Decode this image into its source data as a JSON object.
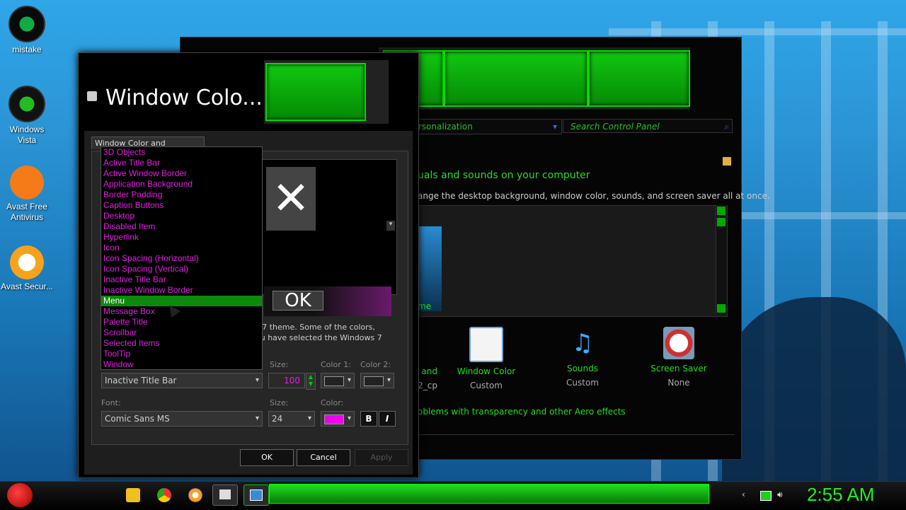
{
  "desktop": {
    "icons": [
      {
        "label": "mistake",
        "icon": "disc-icon"
      },
      {
        "label": "Windows Vista",
        "icon": "recycle-bin-icon"
      },
      {
        "label": "Avast Free Antivirus",
        "icon": "avast-icon"
      },
      {
        "label": "Avast Secur...",
        "icon": "avast-secure-browser-icon"
      }
    ]
  },
  "control_panel": {
    "breadcrumb": "rsonalization",
    "search_placeholder": "Search Control Panel",
    "heading": "uals and sounds on your computer",
    "subheading": "ange the desktop background, window color, sounds, and screen saver all at once.",
    "theme_label": "me",
    "items": [
      {
        "label": "and",
        "value": "2_cp"
      },
      {
        "label": "Window Color",
        "value": "Custom",
        "icon": "window-color-icon"
      },
      {
        "label": "Sounds",
        "value": "Custom",
        "icon": "sounds-icon"
      },
      {
        "label": "Screen Saver",
        "value": "None",
        "icon": "screen-saver-icon"
      }
    ],
    "aero_link": "oblems with transparency and other Aero effects"
  },
  "dialog": {
    "title": "Window Colo...",
    "tab": "Window Color and Appearance",
    "preview_ok": "OK",
    "description_line1": "s 7 theme.  Some of the colors,",
    "description_line2": "ou have selected the Windows 7",
    "item_dropdown": {
      "options": [
        "3D Objects",
        "Active Title Bar",
        "Active Window Border",
        "Application Background",
        "Border Padding",
        "Caption Buttons",
        "Desktop",
        "Disabled Item",
        "Hyperlink",
        "Icon",
        "Icon Spacing (Horizontal)",
        "Icon Spacing (Vertical)",
        "Inactive Title Bar",
        "Inactive Window Border",
        "Menu",
        "Message Box",
        "Palette Title",
        "Scrollbar",
        "Selected Items",
        "ToolTip",
        "Window"
      ],
      "highlighted": "Menu",
      "selected_value": "Inactive Title Bar"
    },
    "size_label": "Size:",
    "size_value": "100",
    "color1_label": "Color 1:",
    "color2_label": "Color 2:",
    "font_label": "Font:",
    "font_value": "Comic Sans MS",
    "font_size_label": "Size:",
    "font_size_value": "24",
    "font_color_label": "Color:",
    "font_color": "#ee00ee",
    "bold_label": "B",
    "italic_label": "I",
    "ok": "OK",
    "cancel": "Cancel",
    "apply": "Apply"
  },
  "taskbar": {
    "clock": "2:55 AM",
    "accent": "#22ee22"
  }
}
